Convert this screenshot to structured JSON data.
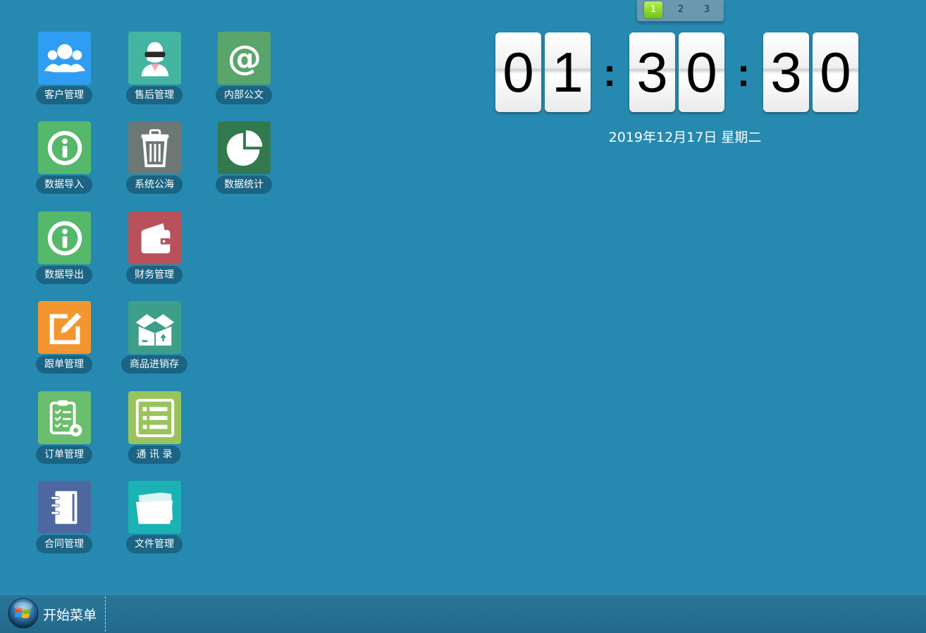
{
  "desktop": {
    "apps": [
      {
        "id": "customer",
        "label": "客户管理",
        "icon": "users-icon",
        "color": "#2f9ef2"
      },
      {
        "id": "aftersales",
        "label": "售后管理",
        "icon": "support-agent-icon",
        "color": "#43b5a0"
      },
      {
        "id": "internal-docs",
        "label": "内部公文",
        "icon": "at-sign-icon",
        "color": "#5aa56c"
      },
      {
        "id": "data-import",
        "label": "数据导入",
        "icon": "info-icon",
        "color": "#55b86b"
      },
      {
        "id": "recycle",
        "label": "系统公海",
        "icon": "trash-icon",
        "color": "#6d7776"
      },
      {
        "id": "statistics",
        "label": "数据统计",
        "icon": "pie-chart-icon",
        "color": "#327a4e"
      },
      {
        "id": "data-export",
        "label": "数据导出",
        "icon": "info-icon",
        "color": "#55b86b"
      },
      {
        "id": "finance",
        "label": "财务管理",
        "icon": "wallet-icon",
        "color": "#b85159"
      },
      {
        "id": "followup",
        "label": "跟单管理",
        "icon": "edit-icon",
        "color": "#f49630"
      },
      {
        "id": "inventory",
        "label": "商品进销存",
        "icon": "box-icon",
        "color": "#3d9e8a"
      },
      {
        "id": "orders",
        "label": "订单管理",
        "icon": "checklist-icon",
        "color": "#6bbe6b"
      },
      {
        "id": "contacts",
        "label": "通 讯 录",
        "icon": "list-icon",
        "color": "#99c45b"
      },
      {
        "id": "contracts",
        "label": "合同管理",
        "icon": "notebook-icon",
        "color": "#4f67a0"
      },
      {
        "id": "files",
        "label": "文件管理",
        "icon": "folder-icon",
        "color": "#1ab2b3"
      }
    ]
  },
  "pager": {
    "pages": [
      "1",
      "2",
      "3"
    ],
    "active": "1"
  },
  "clock": {
    "h1": "0",
    "h2": "1",
    "sep": ":",
    "m1": "3",
    "m2": "0",
    "s1": "3",
    "s2": "0"
  },
  "date": "2019年12月17日 星期二",
  "taskbar": {
    "start_label": "开始菜单",
    "start_icon": "windows-orb-icon"
  }
}
